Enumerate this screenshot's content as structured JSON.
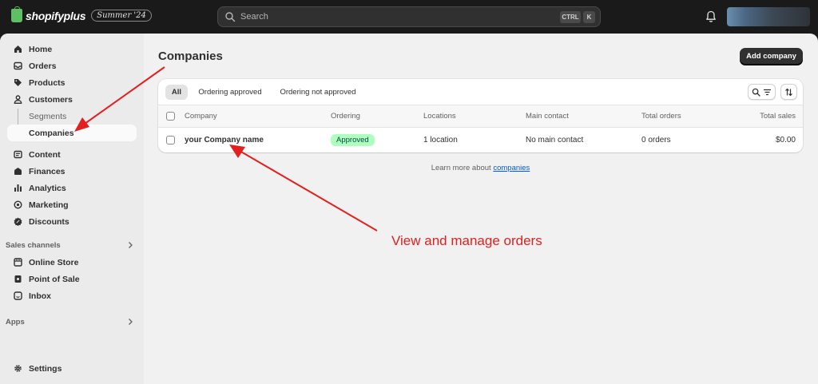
{
  "brand": {
    "logo_text": "shopifyplus",
    "edition": "Summer '24"
  },
  "topbar": {
    "search_placeholder": "Search",
    "shortcut_ctrl": "CTRL",
    "shortcut_key": "K"
  },
  "sidebar": {
    "items": [
      {
        "label": "Home",
        "icon": "home-icon"
      },
      {
        "label": "Orders",
        "icon": "inbox-tray-icon"
      },
      {
        "label": "Products",
        "icon": "tag-icon"
      },
      {
        "label": "Customers",
        "icon": "person-icon"
      },
      {
        "label": "Segments",
        "icon": ""
      },
      {
        "label": "Companies",
        "icon": ""
      },
      {
        "label": "Content",
        "icon": "content-icon"
      },
      {
        "label": "Finances",
        "icon": "bank-icon"
      },
      {
        "label": "Analytics",
        "icon": "bar-chart-icon"
      },
      {
        "label": "Marketing",
        "icon": "target-icon"
      },
      {
        "label": "Discounts",
        "icon": "discount-icon"
      }
    ],
    "sales_channels_label": "Sales channels",
    "channels": [
      {
        "label": "Online Store",
        "icon": "store-icon"
      },
      {
        "label": "Point of Sale",
        "icon": "pos-icon"
      },
      {
        "label": "Inbox",
        "icon": "chat-icon"
      }
    ],
    "apps_label": "Apps",
    "settings_label": "Settings"
  },
  "main": {
    "title": "Companies",
    "add_button": "Add company",
    "tabs": [
      "All",
      "Ordering approved",
      "Ordering not approved"
    ],
    "selected_tab": "All",
    "columns": [
      "Company",
      "Ordering",
      "Locations",
      "Main contact",
      "Total orders",
      "Total sales"
    ],
    "rows": [
      {
        "company": "your Company name",
        "ordering": "Approved",
        "locations": "1 location",
        "main_contact": "No main contact",
        "total_orders": "0 orders",
        "total_sales": "$0.00"
      }
    ],
    "learn_more_prefix": "Learn more about",
    "learn_more_link": "companies"
  },
  "annotation": {
    "text": "View and manage orders",
    "color": "#e32020"
  },
  "colors": {
    "topbar": "#1a1a1a",
    "accent_primary": "#303030",
    "approved_badge_bg": "#affebf",
    "approved_badge_text": "#014b40",
    "link": "#005bd3"
  }
}
